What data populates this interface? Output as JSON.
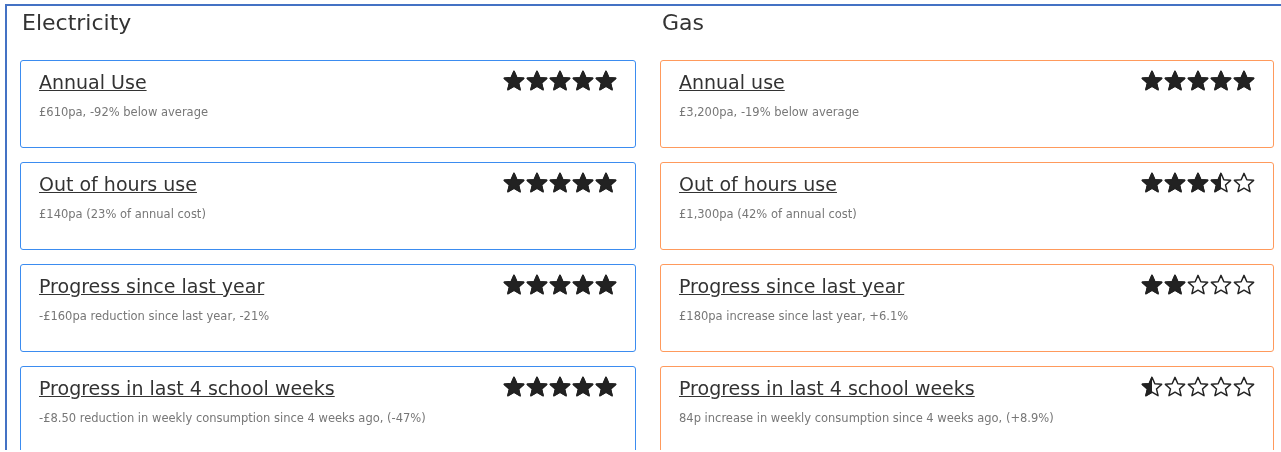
{
  "sections": [
    {
      "title": "Electricity",
      "kind": "electricity",
      "cards": [
        {
          "title": "Annual Use",
          "detail": "£610pa, -92% below average",
          "stars": 5
        },
        {
          "title": "Out of hours use",
          "detail": "£140pa (23% of annual cost)",
          "stars": 5
        },
        {
          "title": "Progress since last year",
          "detail": "-£160pa reduction since last year, -21%",
          "stars": 5
        },
        {
          "title": "Progress in last 4 school weeks",
          "detail": "-£8.50 reduction in weekly consumption since 4 weeks ago, (-47%)",
          "stars": 5
        }
      ]
    },
    {
      "title": "Gas",
      "kind": "gas",
      "cards": [
        {
          "title": "Annual use",
          "detail": "£3,200pa, -19% below average",
          "stars": 5
        },
        {
          "title": "Out of hours use",
          "detail": "£1,300pa (42% of annual cost)",
          "stars": 3.5
        },
        {
          "title": "Progress since last year",
          "detail": "£180pa increase since last year, +6.1%",
          "stars": 2
        },
        {
          "title": "Progress in last 4 school weeks",
          "detail": "84p increase in weekly consumption since 4 weeks ago, (+8.9%)",
          "stars": 0.5
        }
      ]
    }
  ]
}
